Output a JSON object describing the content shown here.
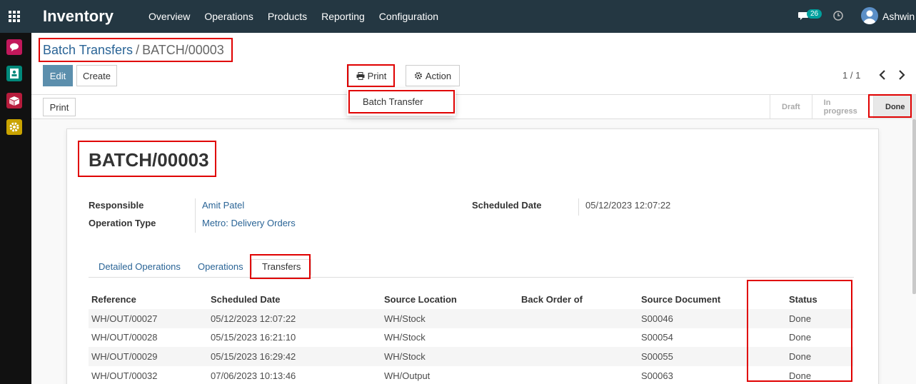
{
  "topbar": {
    "app_title": "Inventory",
    "menu": [
      "Overview",
      "Operations",
      "Products",
      "Reporting",
      "Configuration"
    ],
    "notification_count": "26",
    "user_name": "Ashwin"
  },
  "sidebar": {
    "items": [
      {
        "icon": "discuss-icon",
        "color": "#c2185b"
      },
      {
        "icon": "contacts-icon",
        "color": "#00897b"
      },
      {
        "icon": "inventory-icon",
        "color": "#b71c3c"
      },
      {
        "icon": "settings-icon",
        "color": "#c9a300"
      }
    ]
  },
  "breadcrumb": {
    "parent": "Batch Transfers",
    "separator": "/",
    "current": "BATCH/00003"
  },
  "toolbar": {
    "edit_label": "Edit",
    "create_label": "Create",
    "print_label": "Print",
    "action_label": "Action"
  },
  "print_menu": {
    "items": [
      "Batch Transfer"
    ]
  },
  "pager": {
    "value": "1 / 1"
  },
  "statusbar": {
    "print_label": "Print",
    "stages": [
      "Draft",
      "In progress",
      "Done"
    ],
    "active_stage": "Done"
  },
  "record": {
    "name": "BATCH/00003",
    "fields": {
      "responsible_label": "Responsible",
      "responsible_value": "Amit Patel",
      "operation_type_label": "Operation Type",
      "operation_type_value": "Metro: Delivery Orders",
      "scheduled_date_label": "Scheduled Date",
      "scheduled_date_value": "05/12/2023 12:07:22"
    }
  },
  "tabs": [
    "Detailed Operations",
    "Operations",
    "Transfers"
  ],
  "active_tab": "Transfers",
  "table": {
    "columns": [
      "Reference",
      "Scheduled Date",
      "Source Location",
      "Back Order of",
      "Source Document",
      "Status"
    ],
    "rows": [
      [
        "WH/OUT/00027",
        "05/12/2023 12:07:22",
        "WH/Stock",
        "",
        "S00046",
        "Done"
      ],
      [
        "WH/OUT/00028",
        "05/15/2023 16:21:10",
        "WH/Stock",
        "",
        "S00054",
        "Done"
      ],
      [
        "WH/OUT/00029",
        "05/15/2023 16:29:42",
        "WH/Stock",
        "",
        "S00055",
        "Done"
      ],
      [
        "WH/OUT/00032",
        "07/06/2023 10:13:46",
        "WH/Output",
        "",
        "S00063",
        "Done"
      ]
    ]
  },
  "colors": {
    "navbar": "#243742",
    "primary": "#5c8fad",
    "link": "#2a6496",
    "annotation": "#e00000"
  }
}
